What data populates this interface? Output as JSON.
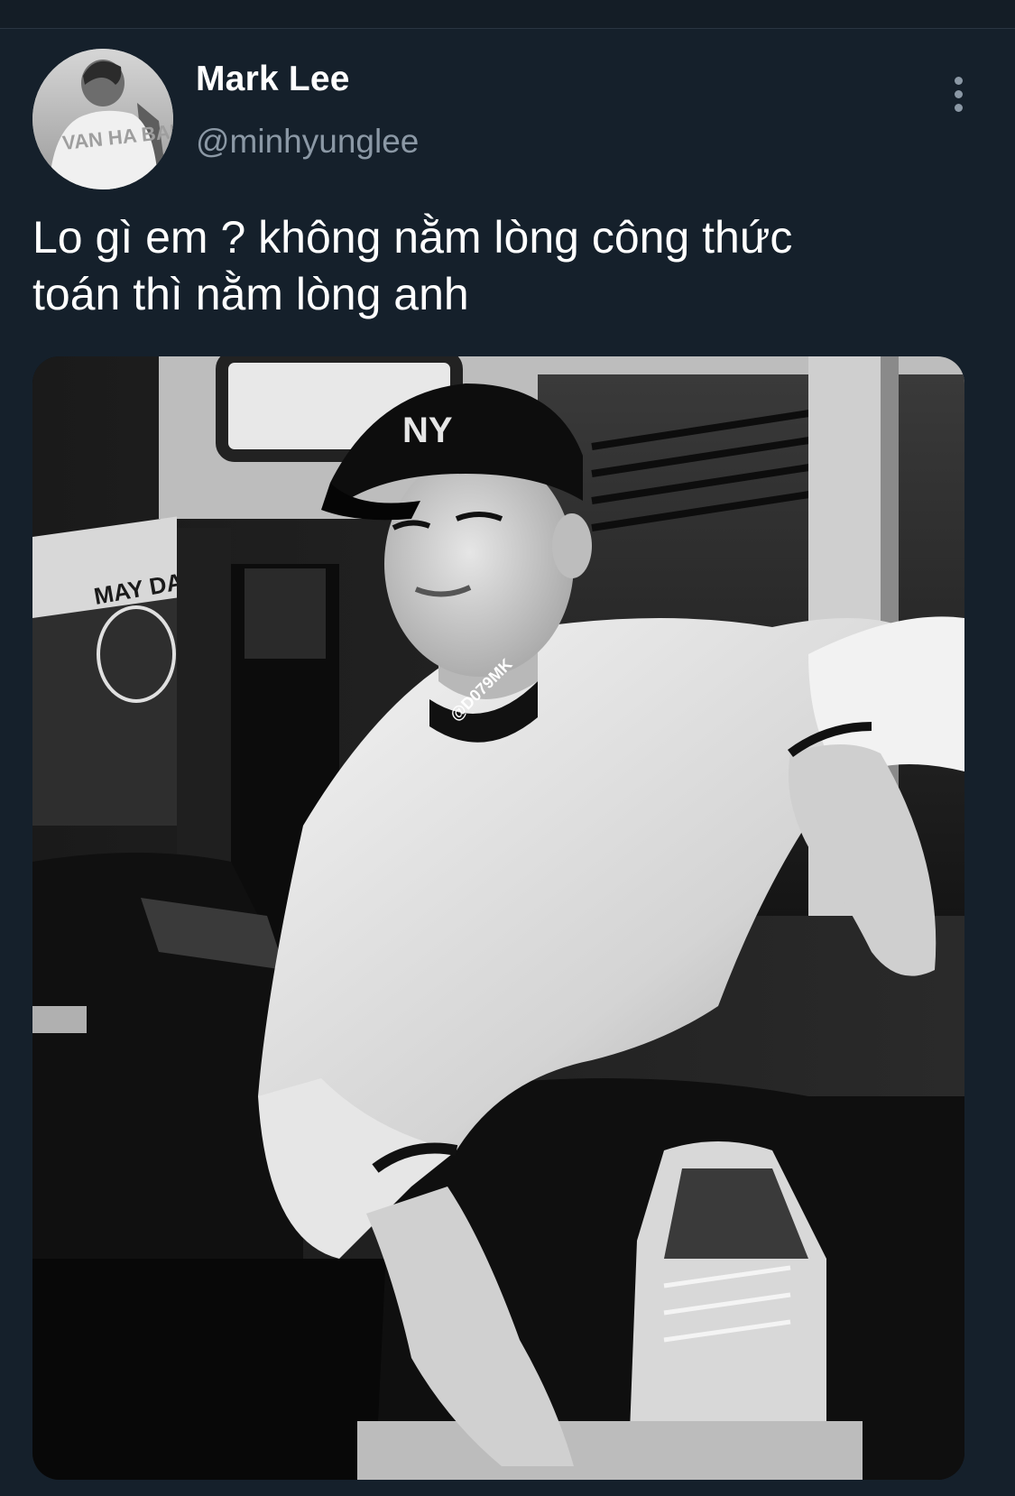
{
  "tweet": {
    "author": {
      "display_name": "Mark Lee",
      "handle": "@minhyunglee",
      "avatar_shirt_text": "VAN HA BALA"
    },
    "text": "Lo gì em ? không nằm lòng công thức\ntoán thì nằm lòng anh",
    "media": {
      "watermark": "@D079MK",
      "cap_logo": "NY",
      "sign_text": "MAY DA"
    }
  },
  "icons": {
    "more": "more-vertical-icon"
  },
  "colors": {
    "background": "#15202b",
    "secondary_text": "#8b98a5",
    "primary_text": "#ffffff"
  }
}
